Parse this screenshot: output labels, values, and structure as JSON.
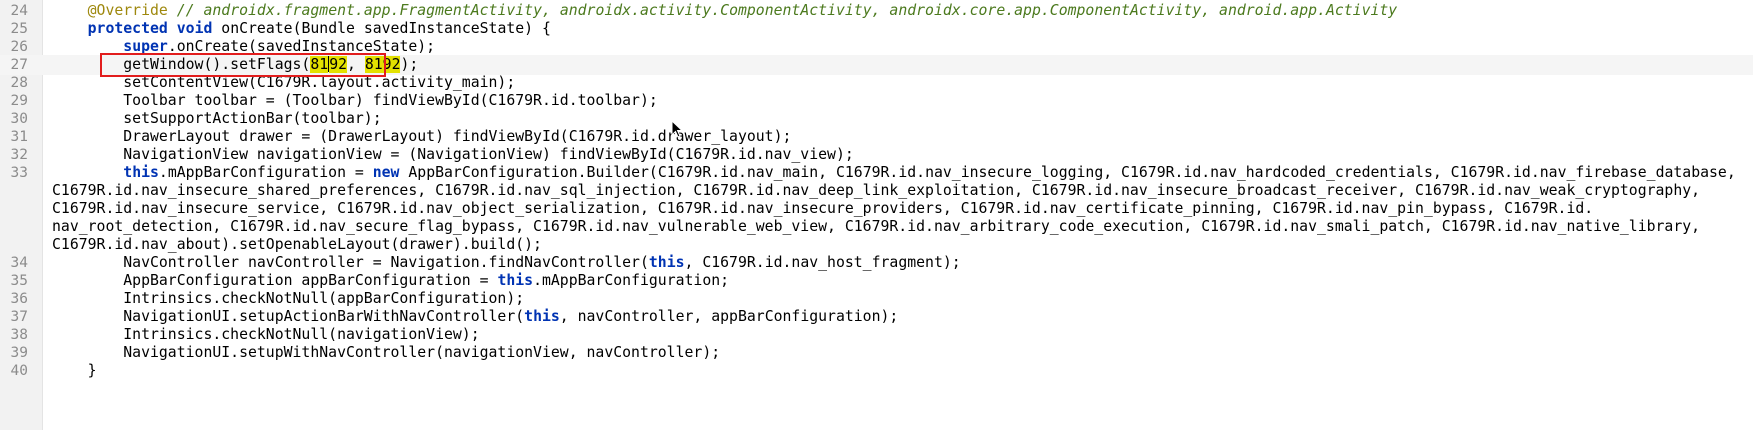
{
  "editor": {
    "lines": [
      {
        "n": "24",
        "parts": [
          {
            "t": "    "
          },
          {
            "t": "@Override",
            "c": "ann"
          },
          {
            "t": " "
          },
          {
            "t": "// androidx.fragment.app.FragmentActivity, androidx.activity.ComponentActivity, androidx.core.app.ComponentActivity, android.app.Activity",
            "c": "cmt"
          }
        ]
      },
      {
        "n": "25",
        "parts": [
          {
            "t": "    "
          },
          {
            "t": "protected",
            "c": "kw"
          },
          {
            "t": " "
          },
          {
            "t": "void",
            "c": "kw"
          },
          {
            "t": " onCreate(Bundle savedInstanceState) {"
          }
        ]
      },
      {
        "n": "26",
        "parts": [
          {
            "t": "        "
          },
          {
            "t": "super",
            "c": "kw"
          },
          {
            "t": ".onCreate(savedInstanceState);"
          }
        ]
      },
      {
        "n": "27",
        "current": true,
        "parts": [
          {
            "t": "        getWindow().setFlags("
          },
          {
            "t": "81",
            "c": "hl"
          },
          {
            "caret": true
          },
          {
            "t": "92",
            "c": "hl"
          },
          {
            "t": ", "
          },
          {
            "t": "8192",
            "c": "hl"
          },
          {
            "t": ");"
          }
        ]
      },
      {
        "n": "28",
        "parts": [
          {
            "t": "        setContentView(C1679R.layout.activity_main);"
          }
        ]
      },
      {
        "n": "29",
        "parts": [
          {
            "t": "        Toolbar toolbar = (Toolbar) findViewById(C1679R.id.toolbar);"
          }
        ]
      },
      {
        "n": "30",
        "parts": [
          {
            "t": "        setSupportActionBar(toolbar);"
          }
        ]
      },
      {
        "n": "31",
        "parts": [
          {
            "t": "        DrawerLayout drawer = (DrawerLayout) findViewById(C1679R.id.drawer_layout);"
          }
        ]
      },
      {
        "n": "32",
        "parts": [
          {
            "t": "        NavigationView navigationView = (NavigationView) findViewById(C1679R.id.nav_view);"
          }
        ]
      },
      {
        "n": "33",
        "parts": [
          {
            "t": "        "
          },
          {
            "t": "this",
            "c": "kw"
          },
          {
            "t": ".mAppBarConfiguration = "
          },
          {
            "t": "new",
            "c": "kw"
          },
          {
            "t": " AppBarConfiguration.Builder(C1679R.id.nav_main, C1679R.id.nav_insecure_logging, C1679R.id.nav_hardcoded_credentials, C1679R.id.nav_firebase_database,"
          }
        ]
      },
      {
        "n": "",
        "parts": [
          {
            "t": "C1679R.id.nav_insecure_shared_preferences, C1679R.id.nav_sql_injection, C1679R.id.nav_deep_link_exploitation, C1679R.id.nav_insecure_broadcast_receiver, C1679R.id.nav_weak_cryptography,"
          }
        ]
      },
      {
        "n": "",
        "parts": [
          {
            "t": "C1679R.id.nav_insecure_service, C1679R.id.nav_object_serialization, C1679R.id.nav_insecure_providers, C1679R.id.nav_certificate_pinning, C1679R.id.nav_pin_bypass, C1679R.id."
          }
        ]
      },
      {
        "n": "",
        "parts": [
          {
            "t": "nav_root_detection, C1679R.id.nav_secure_flag_bypass, C1679R.id.nav_vulnerable_web_view, C1679R.id.nav_arbitrary_code_execution, C1679R.id.nav_smali_patch, C1679R.id.nav_native_library,"
          }
        ]
      },
      {
        "n": "",
        "parts": [
          {
            "t": "C1679R.id.nav_about).setOpenableLayout(drawer).build();"
          }
        ]
      },
      {
        "n": "34",
        "parts": [
          {
            "t": "        NavController navController = Navigation.findNavController("
          },
          {
            "t": "this",
            "c": "kw"
          },
          {
            "t": ", C1679R.id.nav_host_fragment);"
          }
        ]
      },
      {
        "n": "35",
        "parts": [
          {
            "t": "        AppBarConfiguration appBarConfiguration = "
          },
          {
            "t": "this",
            "c": "kw"
          },
          {
            "t": ".mAppBarConfiguration;"
          }
        ]
      },
      {
        "n": "36",
        "parts": [
          {
            "t": "        Intrinsics.checkNotNull(appBarConfiguration);"
          }
        ]
      },
      {
        "n": "37",
        "parts": [
          {
            "t": "        NavigationUI.setupActionBarWithNavController("
          },
          {
            "t": "this",
            "c": "kw"
          },
          {
            "t": ", navController, appBarConfiguration);"
          }
        ]
      },
      {
        "n": "38",
        "parts": [
          {
            "t": "        Intrinsics.checkNotNull(navigationView);"
          }
        ]
      },
      {
        "n": "39",
        "parts": [
          {
            "t": "        NavigationUI.setupWithNavController(navigationView, navController);"
          }
        ]
      },
      {
        "n": "40",
        "parts": [
          {
            "t": "    }"
          }
        ]
      }
    ]
  }
}
